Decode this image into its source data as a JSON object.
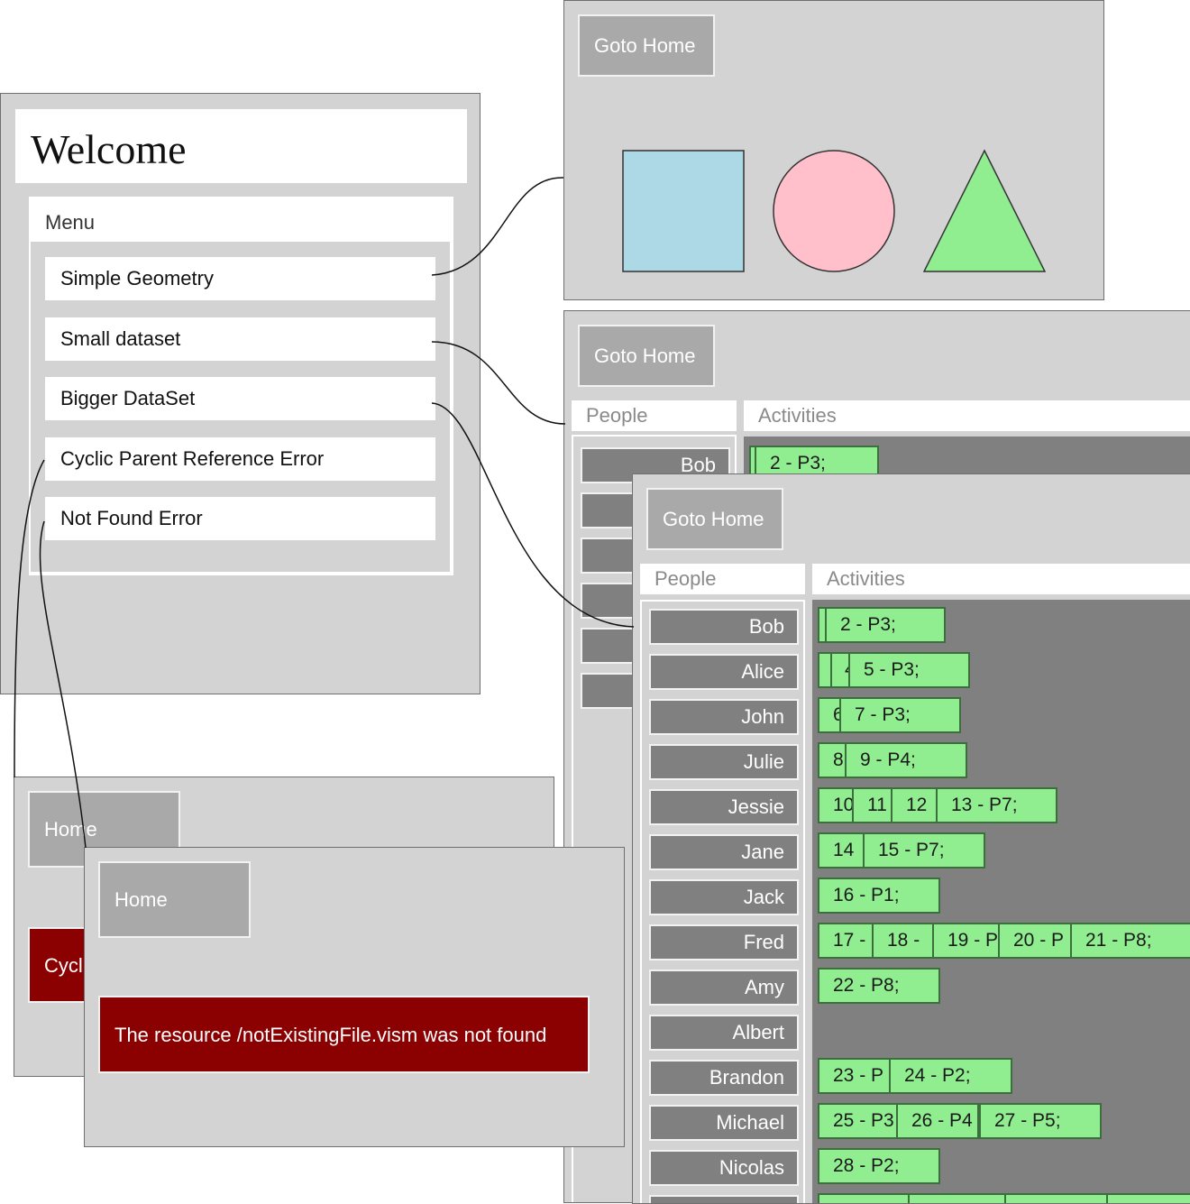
{
  "home": {
    "title": "Welcome",
    "menu_title": "Menu",
    "menu_items": [
      "Simple Geometry",
      "Small dataset",
      "Bigger DataSet",
      "Cyclic Parent Reference Error",
      "Not Found Error"
    ]
  },
  "geometry": {
    "goto_home_label": "Goto Home",
    "shapes": [
      {
        "name": "square",
        "color": "#add8e6"
      },
      {
        "name": "circle",
        "color": "#ffc0cb"
      },
      {
        "name": "triangle",
        "color": "#90ee90"
      }
    ]
  },
  "small_dataset": {
    "goto_home_label": "Goto Home",
    "people_header": "People",
    "activities_header": "Activities",
    "first_person": "Bob",
    "first_activity": "2 - P3;"
  },
  "bigger_dataset": {
    "goto_home_label": "Goto Home",
    "people_header": "People",
    "activities_header": "Activities",
    "rows": [
      {
        "person": "Bob",
        "activities": [
          "",
          "2 - P3;"
        ]
      },
      {
        "person": "Alice",
        "activities": [
          "",
          "4",
          "5 - P3;"
        ]
      },
      {
        "person": "John",
        "activities": [
          "6",
          "7 - P3;"
        ]
      },
      {
        "person": "Julie",
        "activities": [
          "8",
          "9 - P4;"
        ]
      },
      {
        "person": "Jessie",
        "activities": [
          "10",
          "11",
          "12",
          "13 - P7;"
        ]
      },
      {
        "person": "Jane",
        "activities": [
          "14",
          "15 - P7;"
        ]
      },
      {
        "person": "Jack",
        "activities": [
          "16 - P1;"
        ]
      },
      {
        "person": "Fred",
        "activities": [
          "17 -",
          "18 -",
          "19 - P",
          "20 - P",
          "21 - P8;"
        ]
      },
      {
        "person": "Amy",
        "activities": [
          "22 - P8;"
        ]
      },
      {
        "person": "Albert",
        "activities": []
      },
      {
        "person": "Brandon",
        "activities": [
          "23 - P",
          "24 - P2;"
        ]
      },
      {
        "person": "Michael",
        "activities": [
          "25 - P3",
          "26 - P4",
          "27 - P5;"
        ]
      },
      {
        "person": "Nicolas",
        "activities": [
          "28 - P2;"
        ]
      },
      {
        "person": "",
        "activities": [
          "",
          "",
          "",
          ""
        ]
      }
    ]
  },
  "cyclic_error": {
    "home_label": "Home",
    "error_text": "Cycl"
  },
  "not_found_error": {
    "home_label": "Home",
    "error_text": "The resource /notExistingFile.vism was not found",
    "error_color": "#8b0000"
  }
}
